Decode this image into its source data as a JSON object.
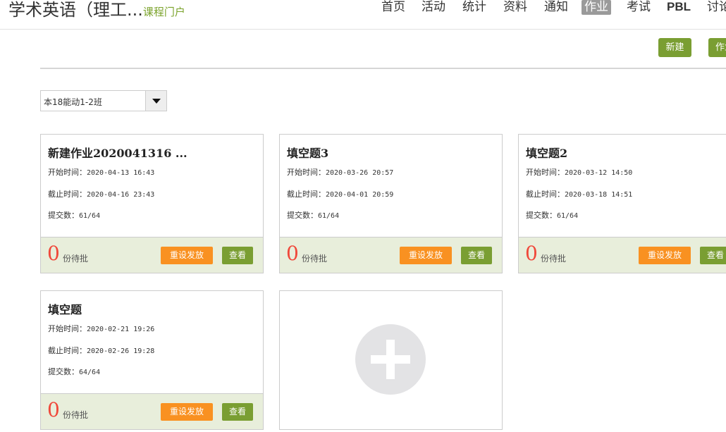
{
  "header": {
    "course_title": "学术英语（理工...",
    "portal_link": "课程门户"
  },
  "nav": [
    "首页",
    "活动",
    "统计",
    "资料",
    "通知",
    "作业",
    "考试",
    "PBL",
    "讨论"
  ],
  "active_nav": "作业",
  "toolbar": {
    "new_label": "新建",
    "second_label": "作业库"
  },
  "class_select": {
    "value": "本18能动1-2班"
  },
  "labels": {
    "start": "开始时间：",
    "end": "截止时间：",
    "submitted": "提交数：",
    "pending": "份待批",
    "reset": "重设发放",
    "view": "查看"
  },
  "cards": [
    {
      "title": "新建作业2020041316 ...",
      "start": "2020-04-13 16:43",
      "end": "2020-04-16 23:43",
      "submitted": "61/64",
      "pending": "0"
    },
    {
      "title": "填空题3",
      "start": "2020-03-26 20:57",
      "end": "2020-04-01 20:59",
      "submitted": "61/64",
      "pending": "0"
    },
    {
      "title": "填空题2",
      "start": "2020-03-12 14:50",
      "end": "2020-03-18 14:51",
      "submitted": "61/64",
      "pending": "0"
    },
    {
      "title": "填空题",
      "start": "2020-02-21 19:26",
      "end": "2020-02-26 19:28",
      "submitted": "64/64",
      "pending": "0"
    }
  ]
}
